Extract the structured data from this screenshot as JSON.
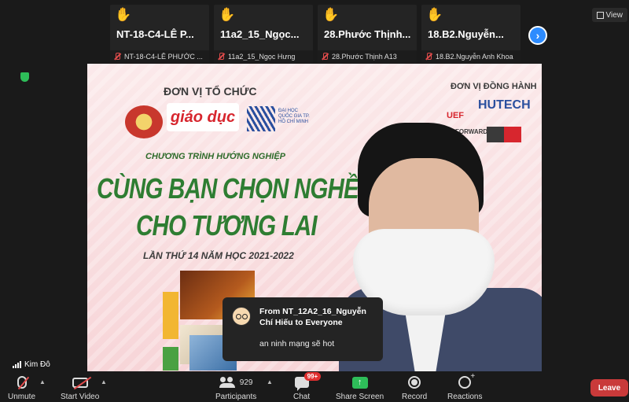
{
  "thumbnails": [
    {
      "name": "NT-18-C4-LÊ P...",
      "label": "NT-18-C4-LÊ PHƯỚC ..."
    },
    {
      "name": "11a2_15_Ngọc...",
      "label": "11a2_15_Ngọc Hưng"
    },
    {
      "name": "28.Phước Thịnh...",
      "label": "28.Phước Thịnh A13"
    },
    {
      "name": "18.B2.Nguyễn...",
      "label": "18.B2.Nguyễn Anh Khoa"
    }
  ],
  "view_label": "View",
  "slide": {
    "org_title": "ĐƠN VỊ TỔ CHỨC",
    "partner_title": "ĐƠN VỊ ĐỒNG HÀNH",
    "logo_gd": "giáo dục",
    "logo_dhqg": "ĐẠI HỌC QUỐC GIA TP. HỒ CHÍ MINH",
    "logo_uef": "UEF",
    "logo_hutech": "HUTECH",
    "logo_forward": "FORWARD NAM",
    "program_sub": "CHƯƠNG TRÌNH HƯỚNG NGHIỆP",
    "headline_1": "CÙNG BẠN CHỌN NGHỀ",
    "headline_2": "CHO TƯƠNG LAI",
    "edition": "LẦN THỨ 14 NĂM HỌC 2021-2022"
  },
  "chat_toast": {
    "from": "From NT_12A2_16_Nguyễn Chí Hiếu to Everyone",
    "message": "an ninh mạng sẽ hot"
  },
  "active_speaker": "Kim Đô",
  "toolbar": {
    "unmute": "Unmute",
    "start_video": "Start Video",
    "participants": "Participants",
    "participant_count": "929",
    "chat": "Chat",
    "chat_badge": "99+",
    "share_screen": "Share Screen",
    "record": "Record",
    "reactions": "Reactions",
    "leave": "Leave"
  },
  "colors": {
    "accent": "#2d8cff",
    "share_green": "#2ebd59",
    "leave_red": "#c93a3a",
    "muted_red": "#e04b4b"
  }
}
